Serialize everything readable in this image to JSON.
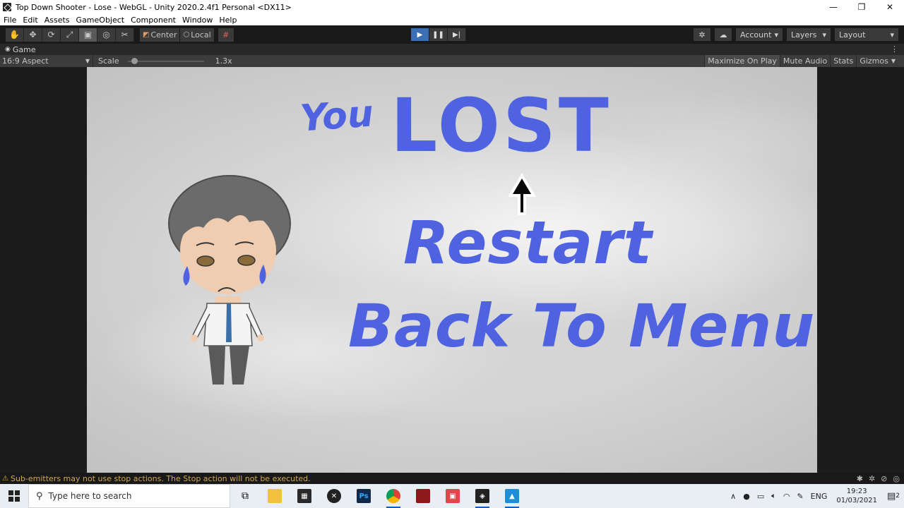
{
  "window": {
    "title": "Top Down Shooter - Lose - WebGL - Unity 2020.2.4f1 Personal <DX11>",
    "minimize": "—",
    "restore": "❐",
    "close": "✕"
  },
  "menu": [
    "File",
    "Edit",
    "Assets",
    "GameObject",
    "Component",
    "Window",
    "Help"
  ],
  "toolbar": {
    "tools": [
      "hand-tool",
      "move-tool",
      "rotate-tool",
      "scale-tool",
      "rect-tool",
      "transform-tool",
      "custom-tool"
    ],
    "pivot_mode": "Center",
    "pivot_rotation": "Local",
    "account": "Account",
    "layers": "Layers",
    "layout": "Layout"
  },
  "game_tab": {
    "label": "Game",
    "aspect": "16:9 Aspect",
    "scale_label": "Scale",
    "scale_value": "1.3x",
    "scale_level": 0.05,
    "maximize_on_play": "Maximize On Play",
    "mute_audio": "Mute Audio",
    "stats": "Stats",
    "gizmos": "Gizmos"
  },
  "game_screen": {
    "you": "You",
    "lost": "LOST",
    "restart": "Restart",
    "back_to_menu": "Back To Menu",
    "text_color": "#4f63e0"
  },
  "status": {
    "warning": "Sub-emitters may not use stop actions. The Stop action will not be executed."
  },
  "taskbar": {
    "search_placeholder": "Type here to search",
    "apps": [
      "task-view",
      "file-explorer",
      "microsoft-store",
      "xbox",
      "photoshop",
      "chrome",
      "app-red",
      "app-game",
      "unity",
      "photos"
    ],
    "language": "ENG",
    "time": "19:23",
    "date": "01/03/2021",
    "notifications": "2"
  }
}
